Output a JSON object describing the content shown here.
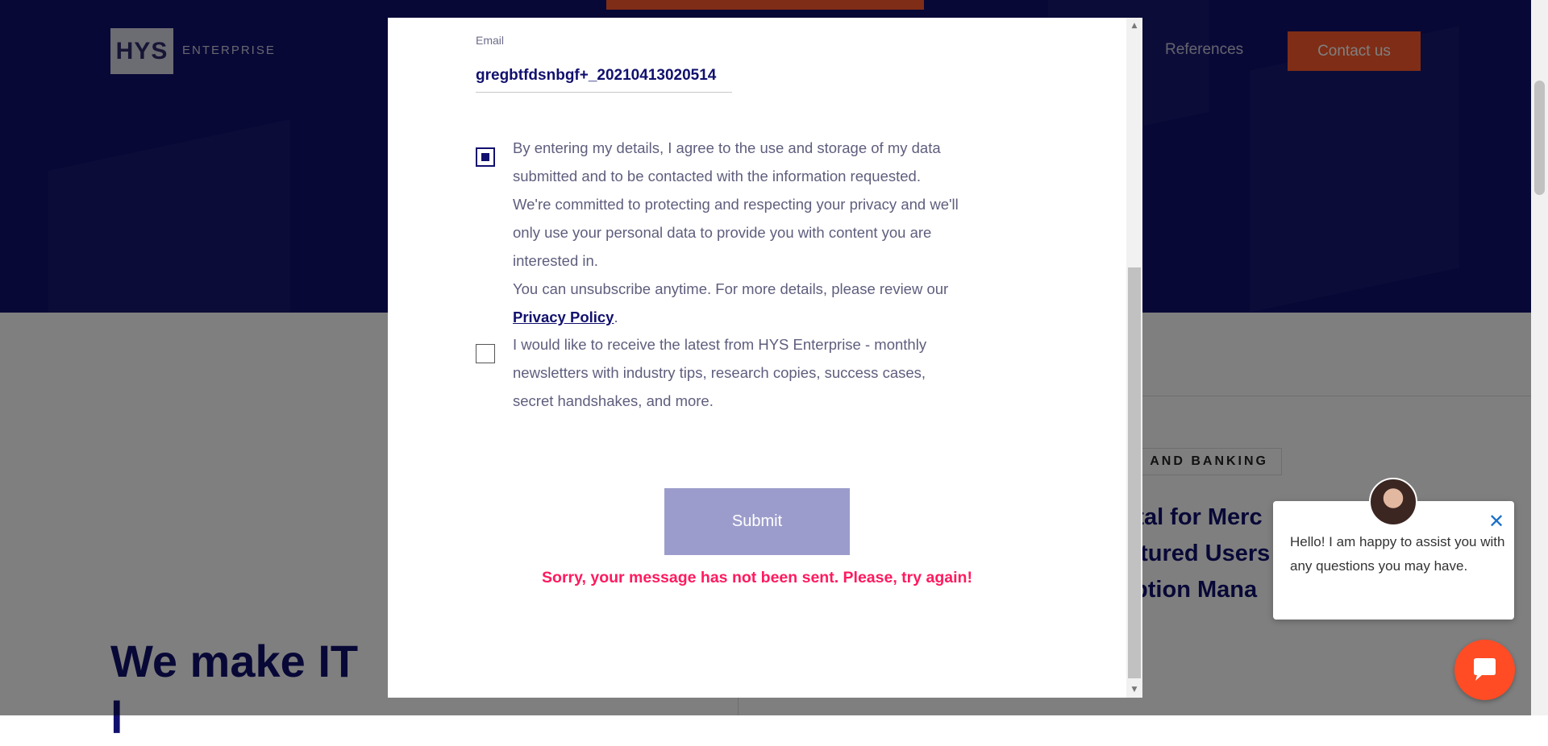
{
  "colors": {
    "brand_navy": "#11106e",
    "accent_orange": "#ff5a2c",
    "submit_bg": "#9c9ccc",
    "error_pink": "#ff1a5f",
    "chat_orange": "#ff4c25"
  },
  "header": {
    "logo_mark": "HYS",
    "logo_word": "ENTERPRISE",
    "nav_references": "References",
    "contact_label": "Contact us"
  },
  "background": {
    "tag": "E AND BANKING",
    "card_title_lines": [
      "rtal for Merc",
      "atured Users",
      "iption Mana"
    ],
    "heading_line1": "We make IT",
    "heading_line2": "l"
  },
  "modal": {
    "email_label": "Email",
    "email_value": "gregbtfdsnbgf+_20210413020514",
    "consent_checked": true,
    "consent_lines": [
      "By entering my details, I agree to the use and storage of my data",
      "submitted and to be contacted with the information requested.",
      "We're committed to protecting and respecting your privacy and we'll",
      "only use your personal data to provide you with content you are",
      "interested in.",
      "You can unsubscribe anytime. For more details, please review our"
    ],
    "privacy_link": "Privacy Policy",
    "privacy_suffix": ".",
    "newsletter_checked": false,
    "newsletter_lines": [
      "I would like to receive the latest from HYS Enterprise - monthly",
      "newsletters with industry tips, research copies, success cases,",
      "secret handshakes, and more."
    ],
    "submit_label": "Submit",
    "error_message": "Sorry, your message has not been sent. Please, try again!"
  },
  "chat": {
    "message": "Hello! I am happy to assist you with any questions you may have.",
    "close_glyph": "✕",
    "avatar_icon": "agent-avatar",
    "launcher_icon": "chat-bubble-icon"
  }
}
